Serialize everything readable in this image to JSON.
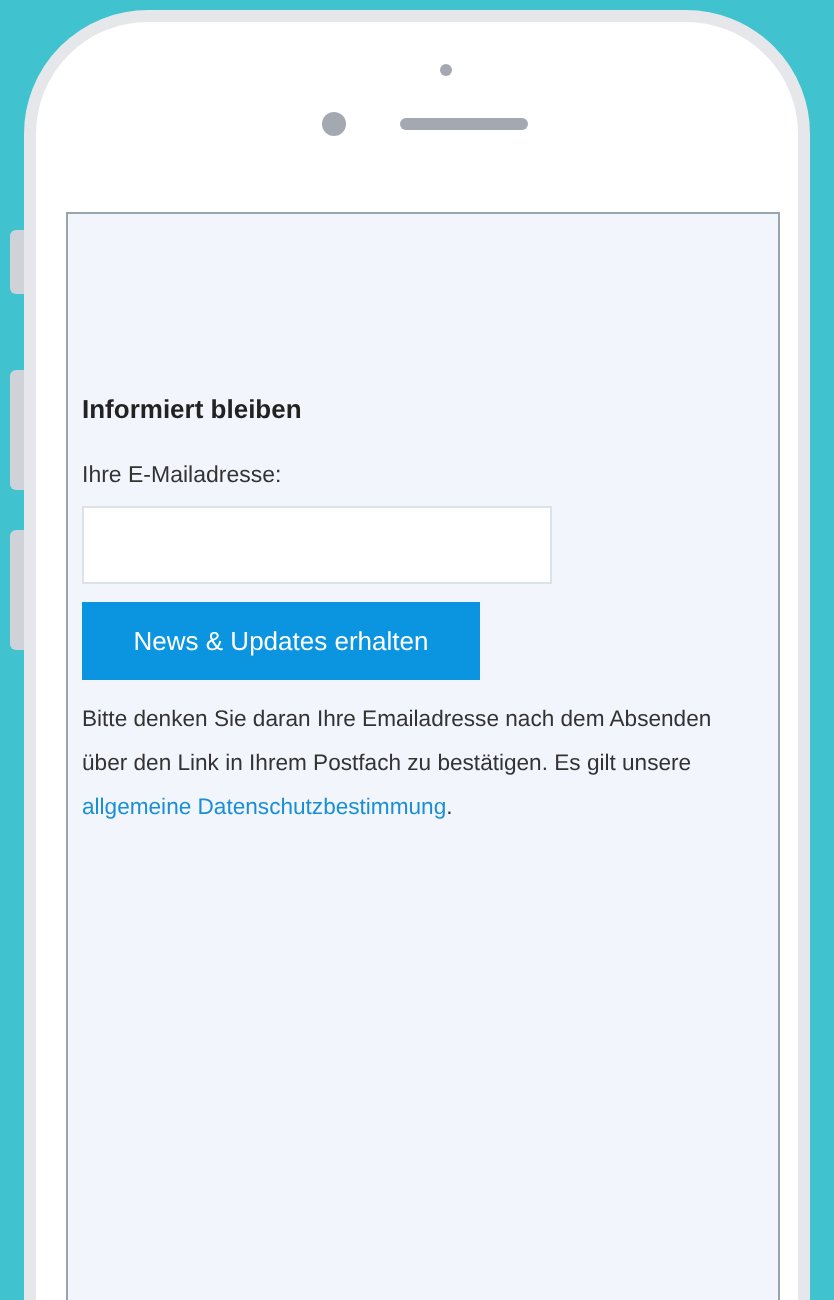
{
  "form": {
    "heading": "Informiert bleiben",
    "email_label": "Ihre E-Mailadresse:",
    "submit_button": "News & Updates erhalten",
    "notice": {
      "text": "Bitte denken Sie daran Ihre Emailadresse nach dem Absenden über den Link in Ihrem Postfach zu bestätigen. Es gilt unsere ",
      "link": "allgemeine Datenschutzbestimmung",
      "text_after": "."
    }
  }
}
